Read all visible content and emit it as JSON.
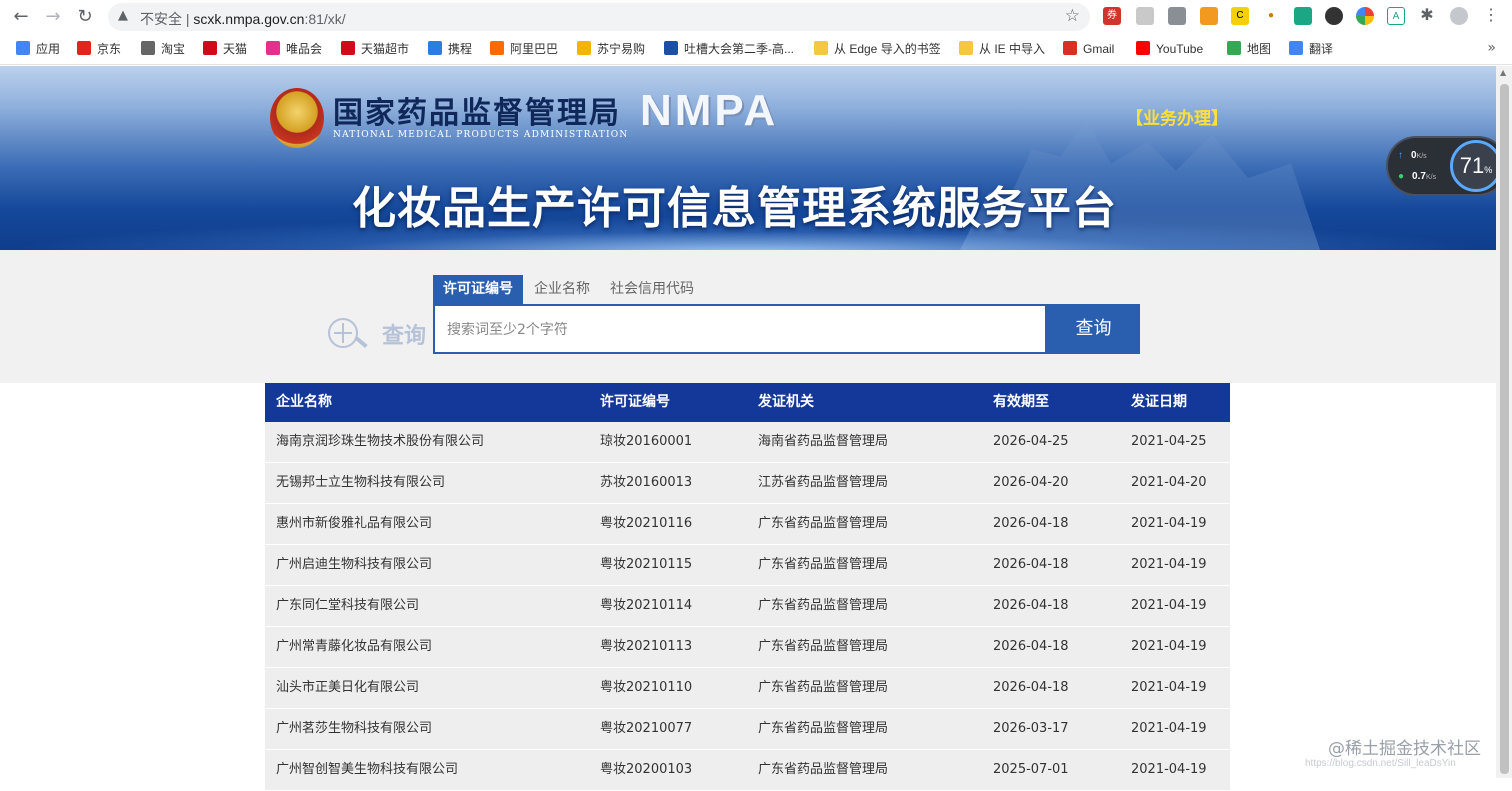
{
  "browser": {
    "security_label": "不安全",
    "url_host": "scxk.nmpa.gov.cn",
    "url_rest": ":81/xk/",
    "bookmarks": [
      {
        "label": "应用",
        "color": "#4285f4"
      },
      {
        "label": "京东",
        "color": "#e1251b"
      },
      {
        "label": "淘宝",
        "color": "#666666"
      },
      {
        "label": "天猫",
        "color": "#d10a1a"
      },
      {
        "label": "唯品会",
        "color": "#e4308c"
      },
      {
        "label": "天猫超市",
        "color": "#d10a1a"
      },
      {
        "label": "携程",
        "color": "#2a7de1"
      },
      {
        "label": "阿里巴巴",
        "color": "#ff6a00"
      },
      {
        "label": "苏宁易购",
        "color": "#f5b400"
      },
      {
        "label": "吐槽大会第二季-高...",
        "color": "#1e4fa6"
      },
      {
        "label": "从 Edge 导入的书签",
        "color": "#f5c842"
      },
      {
        "label": "从 IE 中导入",
        "color": "#f5c842"
      },
      {
        "label": "Gmail",
        "color": "#d93025"
      },
      {
        "label": "YouTube",
        "color": "#ff0000"
      },
      {
        "label": "地图",
        "color": "#34a853"
      },
      {
        "label": "翻译",
        "color": "#4285f4"
      }
    ]
  },
  "banner": {
    "org_cn": "国家药品监督管理局",
    "org_en": "NATIONAL MEDICAL PRODUCTS ADMINISTRATION",
    "brand": "NMPA",
    "business_link": "【业务办理】",
    "platform_title": "化妆品生产许可信息管理系统服务平台"
  },
  "speed_widget": {
    "upload": "0",
    "download": "0.7",
    "unit": "K/s",
    "percent": "71",
    "percent_unit": "%"
  },
  "search": {
    "logo_text": "查询",
    "tabs": [
      "许可证编号",
      "企业名称",
      "社会信用代码"
    ],
    "active_tab": 0,
    "placeholder": "搜索词至少2个字符",
    "button_label": "查询"
  },
  "table": {
    "headers": [
      "企业名称",
      "许可证编号",
      "发证机关",
      "有效期至",
      "发证日期"
    ],
    "rows": [
      [
        "海南京润珍珠生物技术股份有限公司",
        "琼妆20160001",
        "海南省药品监督管理局",
        "2026-04-25",
        "2021-04-25"
      ],
      [
        "无锡邦士立生物科技有限公司",
        "苏妆20160013",
        "江苏省药品监督管理局",
        "2026-04-20",
        "2021-04-20"
      ],
      [
        "惠州市新俊雅礼品有限公司",
        "粤妆20210116",
        "广东省药品监督管理局",
        "2026-04-18",
        "2021-04-19"
      ],
      [
        "广州启迪生物科技有限公司",
        "粤妆20210115",
        "广东省药品监督管理局",
        "2026-04-18",
        "2021-04-19"
      ],
      [
        "广东同仁堂科技有限公司",
        "粤妆20210114",
        "广东省药品监督管理局",
        "2026-04-18",
        "2021-04-19"
      ],
      [
        "广州常青藤化妆品有限公司",
        "粤妆20210113",
        "广东省药品监督管理局",
        "2026-04-18",
        "2021-04-19"
      ],
      [
        "汕头市正美日化有限公司",
        "粤妆20210110",
        "广东省药品监督管理局",
        "2026-04-18",
        "2021-04-19"
      ],
      [
        "广州茗莎生物科技有限公司",
        "粤妆20210077",
        "广东省药品监督管理局",
        "2026-03-17",
        "2021-04-19"
      ],
      [
        "广州智创智美生物科技有限公司",
        "粤妆20200103",
        "广东省药品监督管理局",
        "2025-07-01",
        "2021-04-19"
      ]
    ]
  },
  "watermark": "@稀土掘金技术社区",
  "watermark_small": "https://blog.csdn.net/Sill_leaDsYin"
}
